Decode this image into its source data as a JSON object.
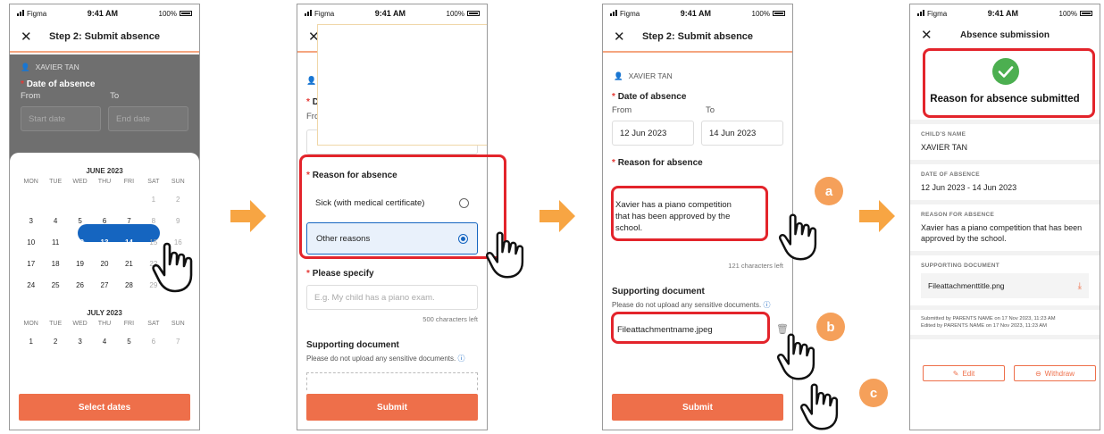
{
  "status": {
    "carrier": "Figma",
    "time": "9:41 AM",
    "battery": "100%"
  },
  "screen1": {
    "title": "Step 2: Submit absence",
    "child_name": "XAVIER TAN",
    "date_label": "Date of absence",
    "from_label": "From",
    "to_label": "To",
    "start_placeholder": "Start date",
    "end_placeholder": "End date",
    "june_title": "JUNE 2023",
    "july_title": "JULY 2023",
    "weekdays": [
      "MON",
      "TUE",
      "WED",
      "THU",
      "FRI",
      "SAT",
      "SUN"
    ],
    "june_weeks": [
      [
        "",
        "",
        "",
        "",
        "",
        "1",
        "2"
      ],
      [
        "3",
        "4",
        "5",
        "6",
        "7",
        "8",
        "9"
      ],
      [
        "10",
        "11",
        "12",
        "13",
        "14",
        "15",
        "16"
      ],
      [
        "17",
        "18",
        "19",
        "20",
        "21",
        "22",
        "23"
      ],
      [
        "24",
        "25",
        "26",
        "27",
        "28",
        "29",
        "30"
      ]
    ],
    "july_week": [
      "1",
      "2",
      "3",
      "4",
      "5",
      "6",
      "7"
    ],
    "selected_days": [
      "12",
      "13",
      "14"
    ],
    "select_button": "Select dates"
  },
  "screen2": {
    "child_partial": "",
    "date_partial": "D",
    "from_partial": "Fro",
    "reason_label": "Reason for absence",
    "option_sick": "Sick (with medical certificate)",
    "option_other": "Other reasons",
    "specify_label": "Please specify",
    "specify_placeholder": "E.g. My child has a piano exam.",
    "chars_left": "500 characters left",
    "doc_label": "Supporting document",
    "doc_hint": "Please do not upload any sensitive documents.",
    "submit": "Submit"
  },
  "screen3": {
    "title": "Step 2: Submit absence",
    "child_name": "XAVIER TAN",
    "date_label": "Date of absence",
    "from_label": "From",
    "to_label": "To",
    "from_value": "12 Jun 2023",
    "to_value": "14 Jun 2023",
    "reason_label": "Reason for absence",
    "reason_text": "Xavier has a piano competition that has been approved by the school.",
    "chars_left": "121 characters left",
    "doc_label": "Supporting document",
    "doc_hint": "Please do not upload any sensitive documents.",
    "file_name": "Fileattachmentname.jpeg",
    "submit": "Submit",
    "badges": [
      "a",
      "b",
      "c"
    ]
  },
  "screen4": {
    "title": "Absence submission",
    "success_text": "Reason for absence submitted",
    "child_caption": "CHILD'S NAME",
    "child_value": "XAVIER TAN",
    "date_caption": "DATE OF ABSENCE",
    "date_value": "12 Jun 2023 - 14 Jun 2023",
    "reason_caption": "REASON FOR ABSENCE",
    "reason_value": "Xavier has a piano competition that has been approved by the school.",
    "doc_caption": "SUPPORTING DOCUMENT",
    "doc_value": "Fileattachmenttitle.png",
    "submitted_by": "Submitted by PARENTS NAME on 17 Nov 2023, 11:23 AM",
    "edited_by": "Edited by PARENTS NAME on 17 Nov 2023, 11:23 AM",
    "edit_button": "Edit",
    "withdraw_button": "Withdraw"
  },
  "colors": {
    "primary": "#ee6f4a",
    "highlight": "#e3242b",
    "selected": "#1565c0",
    "success": "#4caf50",
    "arrow": "#f7a543",
    "badge": "#f5a05a"
  }
}
